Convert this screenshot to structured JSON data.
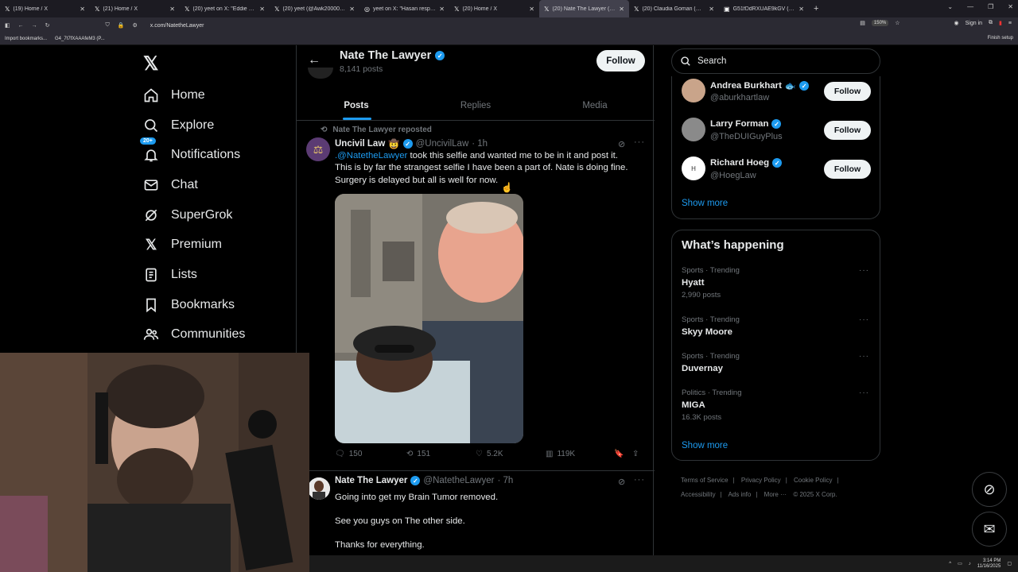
{
  "browser": {
    "tabs": [
      {
        "title": "(19) Home / X",
        "active": false
      },
      {
        "title": "(21) Home / X",
        "active": false
      },
      {
        "title": "(20) yeet on X: \"Eddie gives KF",
        "active": false
      },
      {
        "title": "(20) yeet (@Awk20000) / X",
        "active": false
      },
      {
        "title": "yeet on X: \"Hasan respond",
        "active": false
      },
      {
        "title": "(20) Home / X",
        "active": false
      },
      {
        "title": "(20) Nate The Lawyer (@Nateth",
        "active": true
      },
      {
        "title": "(20) Claudia Goman (@topgun",
        "active": false
      },
      {
        "title": "G51fDdRXUAE9kGV (JPEG Imag",
        "active": false
      }
    ],
    "url": "x.com/NatetheLawyer",
    "zoom": "150%",
    "sign_in": "Sign in",
    "bookmarks": [
      "Import bookmarks...",
      "G4_7t7fXAAAfeM3 (P..."
    ],
    "finish_setup": "Finish setup"
  },
  "nav": {
    "logo": "𝕏",
    "badge": "20+",
    "items": [
      {
        "label": "Home",
        "icon": "home-icon"
      },
      {
        "label": "Explore",
        "icon": "search-icon"
      },
      {
        "label": "Notifications",
        "icon": "bell-icon"
      },
      {
        "label": "Chat",
        "icon": "mail-icon"
      },
      {
        "label": "SuperGrok",
        "icon": "grok-icon"
      },
      {
        "label": "Premium",
        "icon": "x-logo-icon"
      },
      {
        "label": "Lists",
        "icon": "list-icon"
      },
      {
        "label": "Bookmarks",
        "icon": "bookmark-icon"
      },
      {
        "label": "Communities",
        "icon": "people-icon"
      }
    ]
  },
  "profile": {
    "name": "Nate The Lawyer",
    "posts": "8,141 posts",
    "follow": "Follow",
    "tabs": [
      "Posts",
      "Replies",
      "Media"
    ]
  },
  "tweet1": {
    "repost_label": "Nate The Lawyer reposted",
    "name": "Uncivil Law",
    "emoji": "🤠",
    "handle": "@UncivilLaw",
    "time": "· 1h",
    "mention": ".@NatetheLawyer",
    "text": " took this selfie and wanted me to be in it and post it. This is by far the strangest selfie I have been a part of. Nate is doing fine. Surgery is delayed but all is well for now.",
    "replies": "150",
    "reposts": "151",
    "likes": "5.2K",
    "views": "119K"
  },
  "tweet2": {
    "name": "Nate The Lawyer",
    "handle": "@NatetheLawyer",
    "time": "· 7h",
    "lines": [
      "Going into get my Brain Tumor removed.",
      "See you guys on The other side.",
      "Thanks for everything."
    ]
  },
  "search": {
    "placeholder": "Search"
  },
  "who_to_follow": {
    "items": [
      {
        "name": "Andrea Burkhart",
        "emoji": "🐟",
        "handle": "@aburkhartlaw",
        "follow": "Follow"
      },
      {
        "name": "Larry Forman",
        "emoji": "",
        "handle": "@TheDUIGuyPlus",
        "follow": "Follow"
      },
      {
        "name": "Richard Hoeg",
        "emoji": "",
        "handle": "@HoegLaw",
        "follow": "Follow"
      }
    ],
    "show_more": "Show more"
  },
  "happening": {
    "title": "What’s happening",
    "trends": [
      {
        "category": "Sports · Trending",
        "name": "Hyatt",
        "count": "2,990 posts"
      },
      {
        "category": "Sports · Trending",
        "name": "Skyy Moore",
        "count": ""
      },
      {
        "category": "Sports · Trending",
        "name": "Duvernay",
        "count": ""
      },
      {
        "category": "Politics · Trending",
        "name": "MIGA",
        "count": "16.3K posts"
      }
    ],
    "show_more": "Show more"
  },
  "footer": {
    "links": [
      "Terms of Service",
      "|",
      "Privacy Policy",
      "|",
      "Cookie Policy",
      "|",
      "Accessibility",
      "|",
      "Ads info",
      "|",
      "More ···",
      "© 2025 X Corp."
    ]
  },
  "taskbar": {
    "time": "3:14 PM",
    "date": "11/16/2025"
  }
}
